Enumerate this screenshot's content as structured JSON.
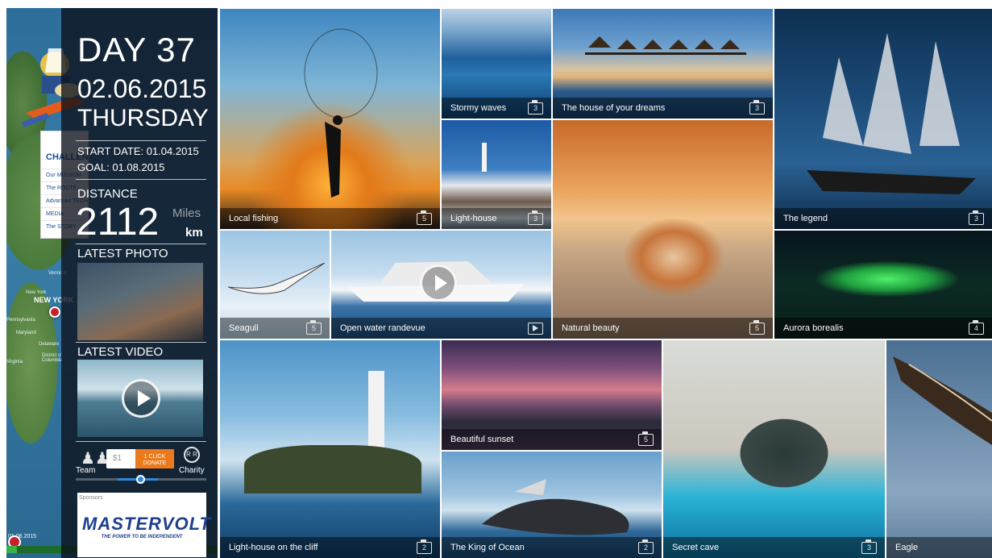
{
  "map": {
    "labels": {
      "new_york": "New York",
      "new_york_big": "NEW YORK",
      "pennsylvania": "Pennsylvania",
      "maryland": "Maryland",
      "delaware": "Delaware",
      "district": "District of Columbia",
      "virginia": "Virginia",
      "vermont": "Vermont"
    },
    "menu": {
      "head": "CHALLENGE",
      "items": [
        "Our MISSION",
        "The ROUTE",
        "Advanced TECHNOLOGY",
        "MEDIA",
        "The STORY"
      ]
    },
    "start_date_short": "01.06.2015",
    "progress": 0.05
  },
  "panel": {
    "day": "DAY 37",
    "date": "02.06.2015",
    "weekday": "THURSDAY",
    "start_date": "START DATE:  01.04.2015",
    "goal": "GOAL:  01.08.2015",
    "distance_label": "DISTANCE",
    "distance_value": "2112",
    "unit_miles": "Miles",
    "unit_km": "km",
    "latest_photo": "LATEST PHOTO",
    "latest_video": "LATEST VIDEO",
    "team": "Team",
    "donate_amount": "$1",
    "donate_button": "1 CLICK DONATE",
    "charity": "Charity",
    "charity_icon_text": "R R",
    "sponsors_label": "Sponsors",
    "sponsor_logo": "MASTERVOLT",
    "sponsor_tagline": "THE POWER TO BE INDEPENDENT"
  },
  "gallery": [
    {
      "id": "local-fishing",
      "caption": "Local fishing",
      "count": "5",
      "media": "photo"
    },
    {
      "id": "stormy-waves",
      "caption": "Stormy waves",
      "count": "3",
      "media": "photo"
    },
    {
      "id": "dream-house",
      "caption": "The house of your dreams",
      "count": "3",
      "media": "photo"
    },
    {
      "id": "the-legend",
      "caption": "The legend",
      "count": "3",
      "media": "photo"
    },
    {
      "id": "light-house",
      "caption": "Light-house",
      "count": "3",
      "media": "photo"
    },
    {
      "id": "natural-beauty",
      "caption": "Natural beauty",
      "count": "5",
      "media": "photo"
    },
    {
      "id": "seagull",
      "caption": "Seagull",
      "count": "5",
      "media": "photo"
    },
    {
      "id": "open-water",
      "caption": "Open water randevue",
      "count": "",
      "media": "video"
    },
    {
      "id": "aurora",
      "caption": "Aurora borealis",
      "count": "4",
      "media": "photo"
    },
    {
      "id": "lighthouse-cliff",
      "caption": "Light-house on the cliff",
      "count": "2",
      "media": "photo"
    },
    {
      "id": "beautiful-sunset",
      "caption": "Beautiful sunset",
      "count": "5",
      "media": "photo"
    },
    {
      "id": "king-of-ocean",
      "caption": "The King of Ocean",
      "count": "2",
      "media": "photo"
    },
    {
      "id": "secret-cave",
      "caption": "Secret cave",
      "count": "3",
      "media": "photo"
    },
    {
      "id": "eagle",
      "caption": "Eagle",
      "count": "",
      "media": "photo"
    }
  ],
  "colors": {
    "donate_orange": "#ec7a1c",
    "slider_blue": "#2e8be0",
    "sponsor_blue": "#1d3f8f",
    "menu_blue": "#1b4f9b",
    "pin_red": "#c6202a",
    "progress_green": "#38b24a"
  }
}
